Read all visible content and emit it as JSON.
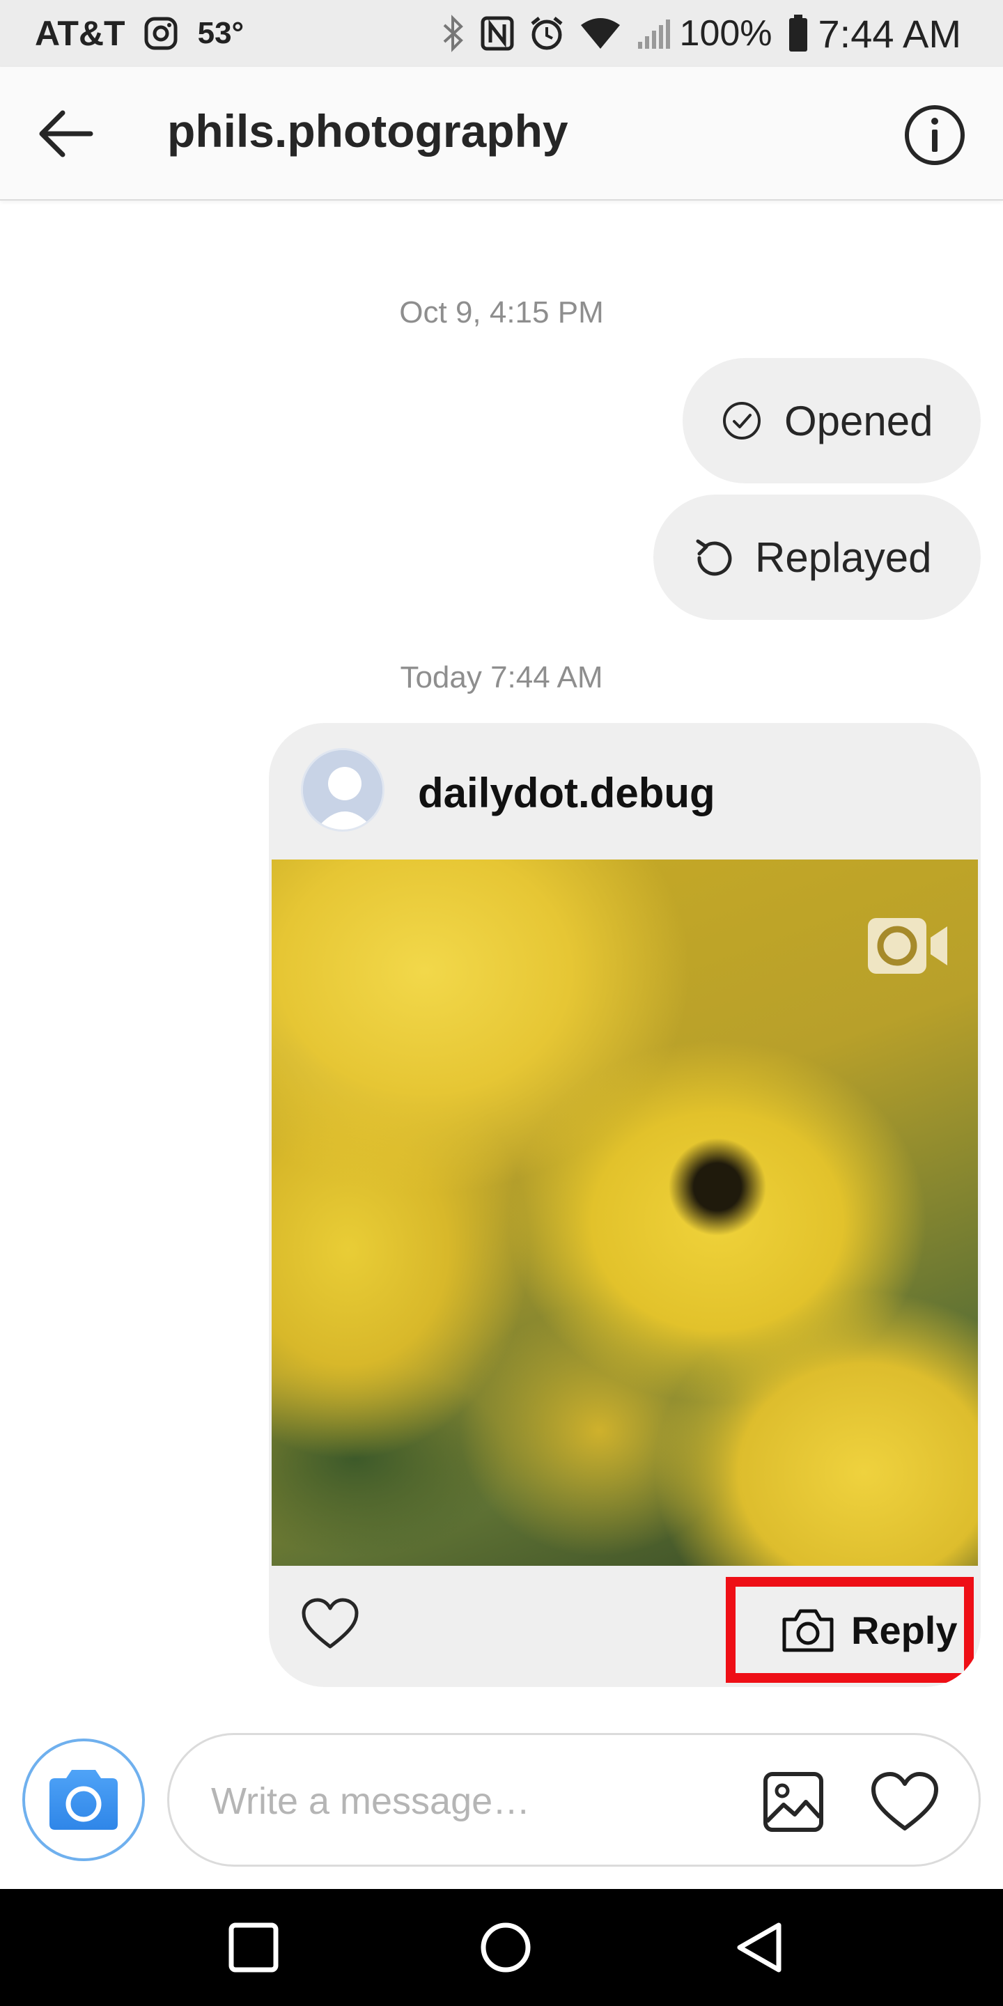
{
  "status_bar": {
    "carrier": "AT&T",
    "temperature": "53°",
    "battery": "100%",
    "time": "7:44 AM",
    "icons": [
      "instagram-icon",
      "bluetooth-icon",
      "nfc-icon",
      "alarm-icon",
      "wifi-icon",
      "signal-icon",
      "battery-icon"
    ]
  },
  "header": {
    "title": "phils.photography",
    "back_icon": "back-arrow-icon",
    "info_icon": "info-icon"
  },
  "chat": {
    "timestamp_1": "Oct 9, 4:15 PM",
    "opened_label": "Opened",
    "replayed_label": "Replayed",
    "timestamp_2": "Today 7:44 AM",
    "story": {
      "username": "dailydot.debug",
      "media_type": "video",
      "reply_label": "Reply"
    }
  },
  "composer": {
    "placeholder": "Write a message…"
  },
  "colors": {
    "accent_blue": "#3897f0",
    "highlight_red": "#ee0f16",
    "bubble_gray": "#efefef"
  }
}
